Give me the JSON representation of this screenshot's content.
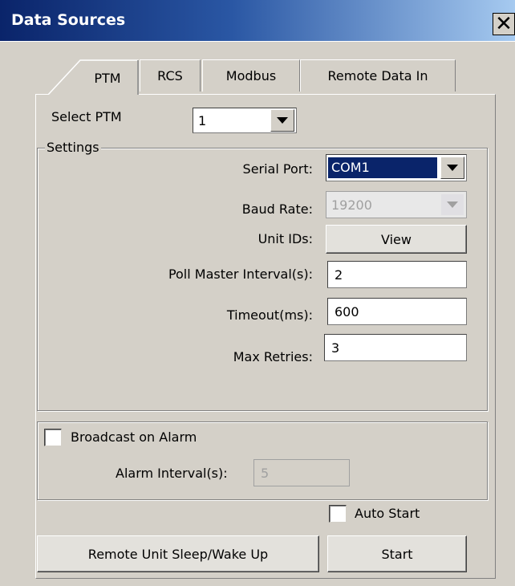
{
  "window": {
    "title": "Data Sources",
    "close_icon": "close-icon"
  },
  "tabs": [
    {
      "label": "PTM",
      "active": true
    },
    {
      "label": "RCS",
      "active": false
    },
    {
      "label": "Modbus",
      "active": false
    },
    {
      "label": "Remote Data In",
      "active": false
    }
  ],
  "select_ptm": {
    "label": "Select PTM",
    "value": "1"
  },
  "settings": {
    "legend": "Settings",
    "serial_port": {
      "label": "Serial Port:",
      "value": "COM1"
    },
    "baud_rate": {
      "label": "Baud Rate:",
      "value": "19200"
    },
    "unit_ids": {
      "label": "Unit IDs:",
      "button": "View"
    },
    "poll_master": {
      "label": "Poll Master Interval(s):",
      "value": "2"
    },
    "timeout": {
      "label": "Timeout(ms):",
      "value": "600"
    },
    "max_retries": {
      "label": "Max Retries:",
      "value": "3"
    }
  },
  "alarm": {
    "broadcast_label": "Broadcast on Alarm",
    "broadcast_checked": false,
    "interval_label": "Alarm Interval(s):",
    "interval_value": "5"
  },
  "auto_start": {
    "label": "Auto Start",
    "checked": false
  },
  "buttons": {
    "sleep_wake": "Remote Unit Sleep/Wake Up",
    "start": "Start"
  }
}
